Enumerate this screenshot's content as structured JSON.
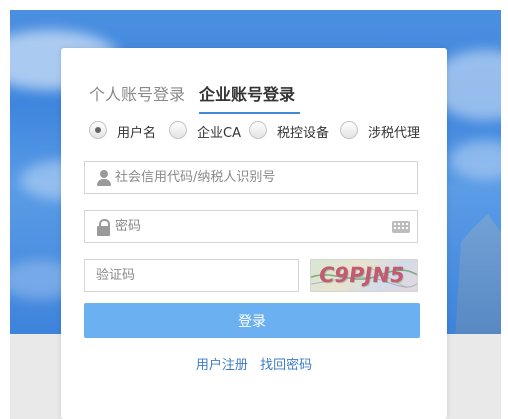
{
  "tabs": {
    "personal": "个人账号登录",
    "enterprise": "企业账号登录",
    "active": "enterprise"
  },
  "login_types": [
    {
      "label": "用户名",
      "checked": true
    },
    {
      "label": "企业CA",
      "checked": false
    },
    {
      "label": "税控设备",
      "checked": false
    },
    {
      "label": "涉税代理",
      "checked": false
    }
  ],
  "form": {
    "username_placeholder": "社会信用代码/纳税人识别号",
    "username_value": "",
    "password_placeholder": "密码",
    "password_value": "",
    "captcha_placeholder": "验证码",
    "captcha_value": "",
    "captcha_image_text": "C9PJN5",
    "login_label": "登录"
  },
  "links": {
    "register": "用户注册",
    "forgot_password": "找回密码"
  },
  "colors": {
    "accent": "#3d8bd9",
    "login_button": "#6bb1f1",
    "link": "#3d7cc4"
  },
  "icons": {
    "username": "user-icon",
    "password": "lock-icon",
    "soft_keyboard": "keyboard-icon"
  }
}
